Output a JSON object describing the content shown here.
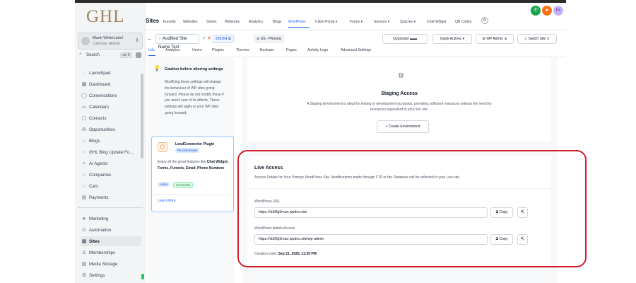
{
  "brand": {
    "logo_text": "GHL",
    "highlight_color": "#d11f2b",
    "accent": "#2563eb"
  },
  "account": {
    "name": "Blank WhiteLabel",
    "location": "Camrose, Alberta"
  },
  "search": {
    "label": "Search",
    "shortcut": "ctrl K"
  },
  "sidebar": {
    "items": [
      {
        "label": "Launchpad",
        "icon": "rocket-icon"
      },
      {
        "label": "Dashboard",
        "icon": "grid-icon"
      },
      {
        "label": "Conversations",
        "icon": "chat-icon"
      },
      {
        "label": "Calendars",
        "icon": "calendar-icon"
      },
      {
        "label": "Contacts",
        "icon": "contacts-icon"
      },
      {
        "label": "Opportunities",
        "icon": "funnel-icon"
      },
      {
        "label": "Blogs",
        "icon": ""
      },
      {
        "label": "GHL Blog Update Fo...",
        "icon": ""
      },
      {
        "label": "AI Agents",
        "icon": "sparkle-icon"
      },
      {
        "label": "Companies",
        "icon": ""
      },
      {
        "label": "Cars",
        "icon": ""
      },
      {
        "label": "Payments",
        "icon": "payments-icon"
      }
    ],
    "bottom_items": [
      {
        "label": "Marketing",
        "icon": "send-icon"
      },
      {
        "label": "Automation",
        "icon": "automation-icon"
      },
      {
        "label": "Sites",
        "icon": "sites-icon",
        "active": true
      },
      {
        "label": "Memberships",
        "icon": "memberships-icon"
      },
      {
        "label": "Media Storage",
        "icon": "media-icon"
      },
      {
        "label": "Settings",
        "icon": "gear-icon"
      }
    ]
  },
  "topnav": {
    "title": "Sites",
    "items": [
      "Funnels",
      "Websites",
      "Stores",
      "Webinars",
      "Analytics",
      "Blogs",
      "WordPress",
      "Client Portal ▾",
      "Forms ▾",
      "Surveys ▾",
      "Quizzes ▾",
      "Chat Widget",
      "QR Codes"
    ],
    "active": "WordPress"
  },
  "site": {
    "name": "Aodified Site Name Test",
    "id": "205264",
    "region": "US - Phoenix",
    "quickstart_label": "Quickstart",
    "quick_actions_label": "Quick Actions",
    "wp_admin_label": "WP Admin",
    "switch_site_label": "Switch Site"
  },
  "subtabs": [
    "Info",
    "Analytics",
    "Users",
    "Plugins",
    "Themes",
    "Backups",
    "Pages",
    "Activity Logs",
    "Advanced Settings"
  ],
  "caution": {
    "title": "Caution before altering settings",
    "body": "Modifying these settings will change the behaviour of WP sites going forward. Please do not modify these if you aren't sure of its effects. These settings will apply to your WP sites going forward."
  },
  "plugin_card": {
    "title": "LeadConnector Plugin",
    "badge": "Recommended",
    "desc_prefix": "Enjoy all the great features like ",
    "desc_bold": "Chat Widget, Forms, Funnels, Email, Phone Numbers",
    "status_active": "Active",
    "status_connected": "Connected",
    "learn_more": "Learn More"
  },
  "staging": {
    "title": "Staging Access",
    "description": "A Staging Environment is ideal for testing or development purposes, providing sufficient resources without the need for resources equivalent to your live site.",
    "button": "+ Create Environment"
  },
  "live": {
    "title": "Live Access",
    "description": "Access Details for Your Primary WordPress Site. Modifications made through FTP or the Database will be reflected in your Live site.",
    "url_label": "WordPress URL",
    "url_value": "https://vb5flg5man.wpdns.site",
    "admin_label": "WordPress Admin Access",
    "admin_value": "https://vb5flg5man.wpdns.site/wp-admin",
    "copy_label": "Copy",
    "creation_prefix": "Creation Date: ",
    "creation_date": "Sep 21, 2025, 11:35 PM"
  }
}
